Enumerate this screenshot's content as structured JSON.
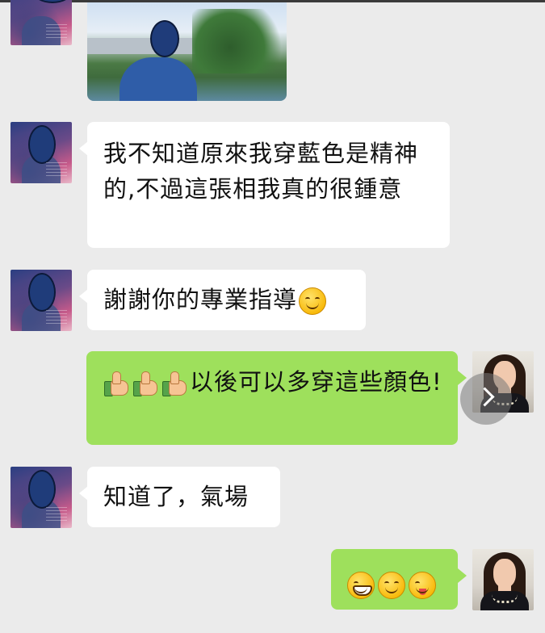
{
  "chat": {
    "messages": [
      {
        "text": "我不知道原來我穿藍色是精神的,不過這張相我真的很鍾意"
      },
      {
        "text": "謝謝你的專業指導"
      },
      {
        "text": "以後可以多穿這些顏色!"
      },
      {
        "text": "知道了，氣場"
      }
    ]
  },
  "icons": {
    "thumbs_up": "thumbs-up-icon",
    "smile": "smile-icon",
    "grin": "grin-icon",
    "wink": "wink-tongue-icon",
    "play": "chevron-right-icon"
  },
  "colors": {
    "background": "#ebebeb",
    "incoming_bubble": "#ffffff",
    "outgoing_bubble": "#9ee05c"
  }
}
